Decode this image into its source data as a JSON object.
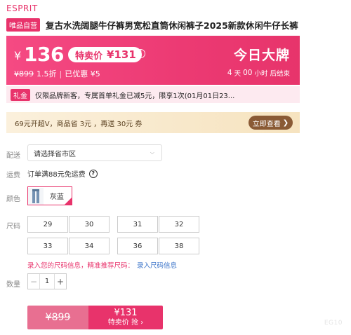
{
  "brand": "ESPRIT",
  "product": {
    "tag": "唯品自营",
    "title": "复古水洗阔腿牛仔裤男宽松直筒休闲裤子2025新款休闲牛仔长裤"
  },
  "price": {
    "currency": "¥",
    "current": "136",
    "special_label": "特卖价",
    "special_amount": "¥131",
    "info_icon": "i",
    "original": "¥899",
    "discount": "1.5折",
    "separator": "|",
    "saved": "已优惠 ¥5",
    "promo_title": "今日大牌",
    "countdown": {
      "days": "4",
      "days_unit": "天",
      "hours": "00",
      "hours_unit": "小时",
      "suffix": "后结束"
    }
  },
  "gift": {
    "tag": "礼金",
    "text": "仅限品牌新客，专属首单礼金已减5元，限享1次(01月01日23..."
  },
  "vip_bar": {
    "text": "69元开超V，商品省 3元 ，再送 30元 券",
    "button": "立即查看",
    "button_arrow": "❯"
  },
  "delivery": {
    "label": "配送",
    "placeholder": "请选择省市区",
    "chevron": "⌵"
  },
  "shipping": {
    "label": "运费",
    "text": "订单满88元免运费",
    "help_icon": "?"
  },
  "color": {
    "label": "颜色",
    "selected": "灰蓝"
  },
  "sizes": {
    "label": "尺码",
    "options": [
      "29",
      "30",
      "31",
      "32",
      "33",
      "34",
      "36",
      "38"
    ],
    "tip": "录入您的尺码信息，精准推荐尺码：",
    "tip_link": "录入尺码信息"
  },
  "quantity": {
    "label": "数量",
    "value": "1",
    "minus": "−",
    "plus": "+"
  },
  "buy": {
    "original": "¥899",
    "price": "¥131",
    "label": "特卖价 抢",
    "arrow": "›"
  },
  "watermark": "EG10",
  "colors": {
    "accent": "#e8336b",
    "banner": "#ec3a73",
    "vip_gold": "#f6e3bf",
    "vip_button": "#8a5a35",
    "link": "#3a73c9"
  }
}
